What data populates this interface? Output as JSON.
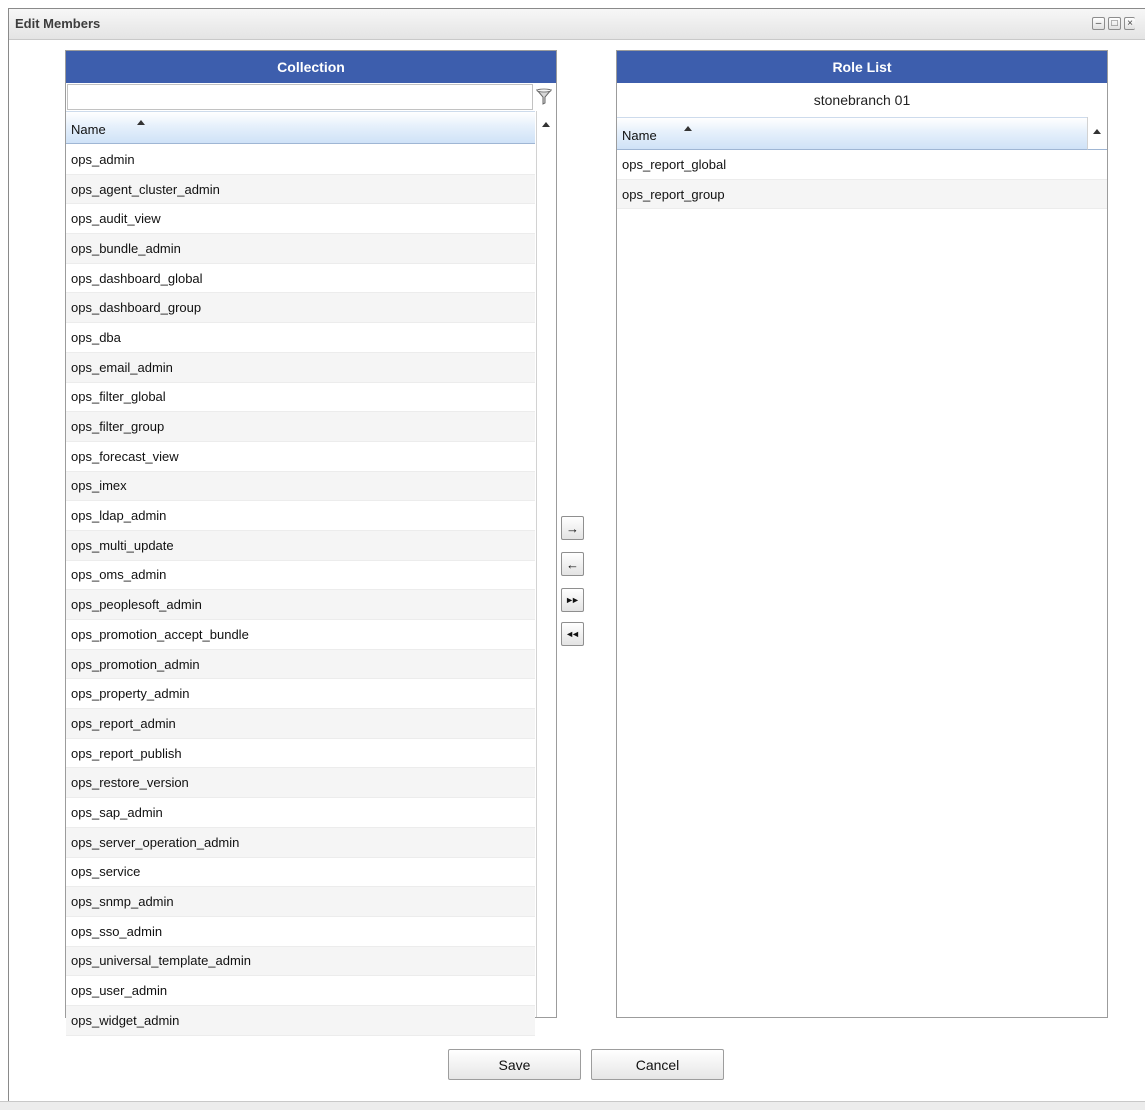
{
  "window": {
    "title": "Edit Members",
    "minimize_label": "–",
    "maximize_label": "□",
    "close_label": "×"
  },
  "collection": {
    "header": "Collection",
    "filter_value": "",
    "column_name": "Name",
    "items": [
      "ops_admin",
      "ops_agent_cluster_admin",
      "ops_audit_view",
      "ops_bundle_admin",
      "ops_dashboard_global",
      "ops_dashboard_group",
      "ops_dba",
      "ops_email_admin",
      "ops_filter_global",
      "ops_filter_group",
      "ops_forecast_view",
      "ops_imex",
      "ops_ldap_admin",
      "ops_multi_update",
      "ops_oms_admin",
      "ops_peoplesoft_admin",
      "ops_promotion_accept_bundle",
      "ops_promotion_admin",
      "ops_property_admin",
      "ops_report_admin",
      "ops_report_publish",
      "ops_restore_version",
      "ops_sap_admin",
      "ops_server_operation_admin",
      "ops_service",
      "ops_snmp_admin",
      "ops_sso_admin",
      "ops_universal_template_admin",
      "ops_user_admin",
      "ops_widget_admin"
    ]
  },
  "role_list": {
    "header": "Role List",
    "subheader": "stonebranch 01",
    "column_name": "Name",
    "items": [
      "ops_report_global",
      "ops_report_group"
    ]
  },
  "transfer": {
    "add_selected": "→",
    "remove_selected": "←",
    "add_all": "►►",
    "remove_all": "◄◄"
  },
  "footer": {
    "save_label": "Save",
    "cancel_label": "Cancel"
  }
}
